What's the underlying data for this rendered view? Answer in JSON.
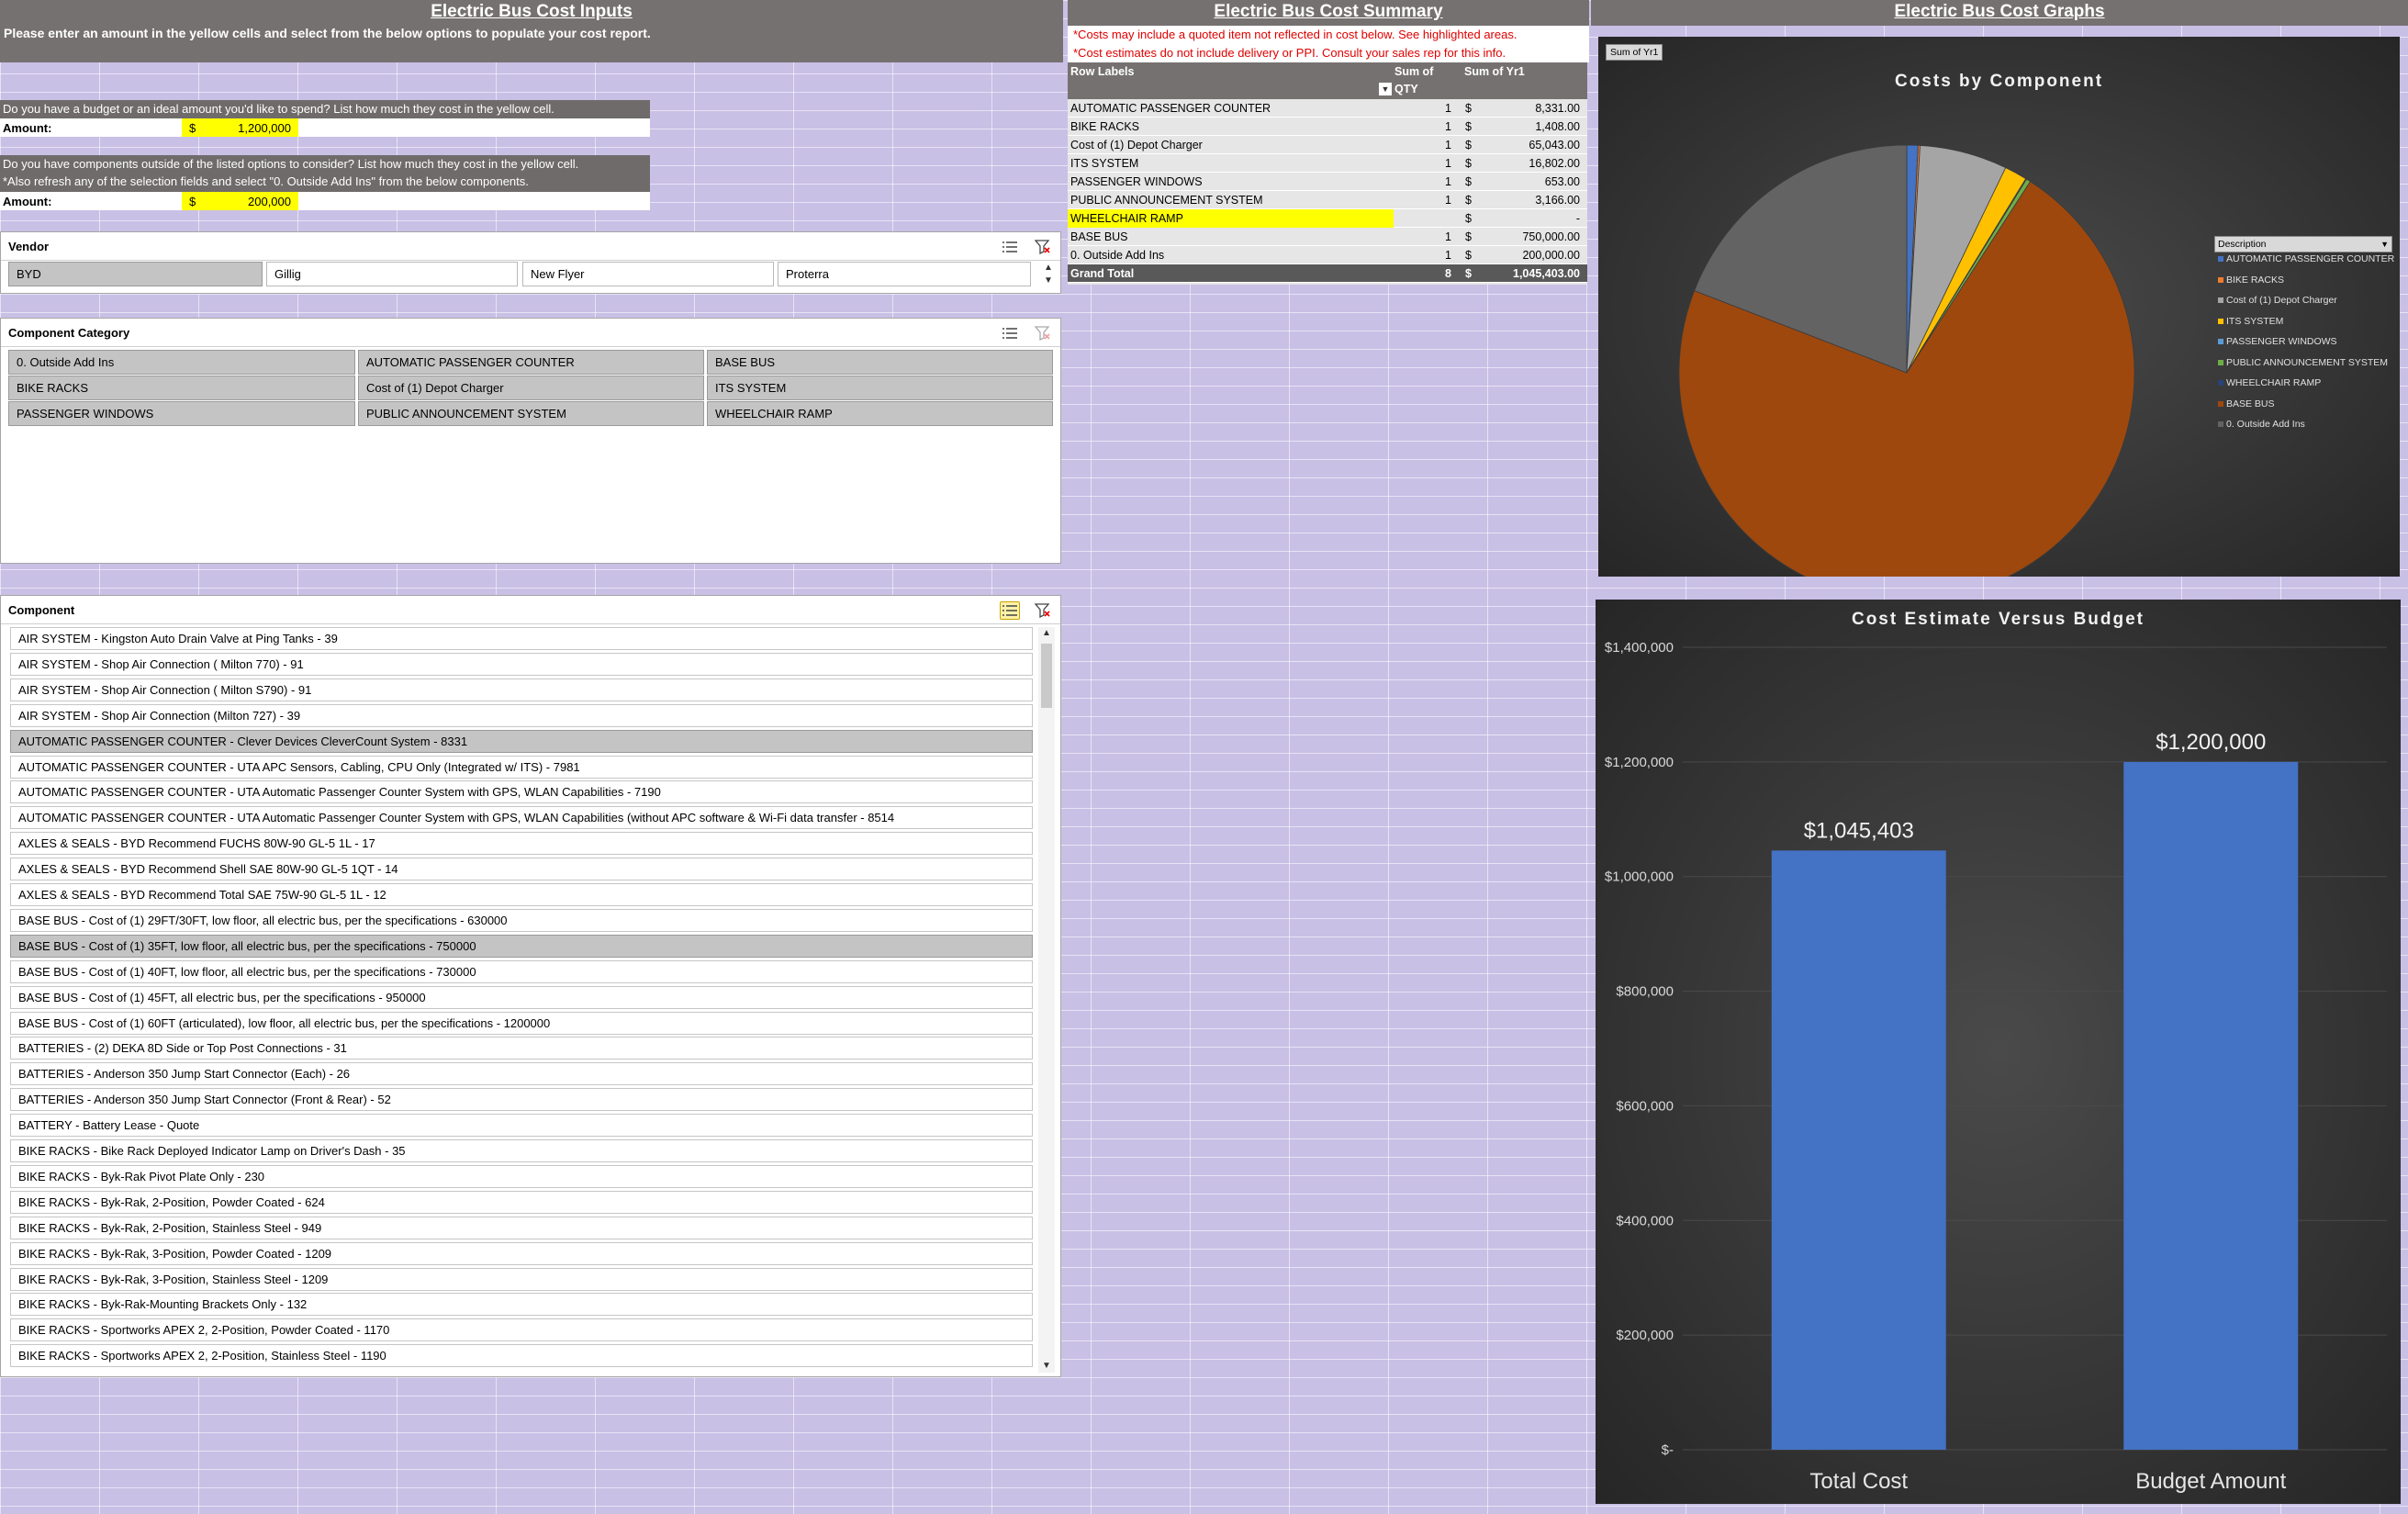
{
  "inputs": {
    "title": "Electric Bus Cost Inputs",
    "subtitle": "Please enter an amount in the yellow cells and select from the below options to populate your cost report.",
    "budget_question": "Do you have a budget or an ideal amount you'd like to spend? List how much they cost in the yellow cell.",
    "amount_label": "Amount:",
    "budget_currency": "$",
    "budget_amount": "1,200,000",
    "outside_question": "Do you have components outside of the listed options to consider? List how much they cost in the yellow cell.",
    "outside_note": "*Also refresh any of the selection fields and select \"0. Outside Add Ins\" from the below components.",
    "outside_currency": "$",
    "outside_amount": "200,000"
  },
  "vendor_slicer": {
    "title": "Vendor",
    "items": [
      "BYD",
      "Gillig",
      "New Flyer",
      "Proterra"
    ],
    "selected": "BYD"
  },
  "category_slicer": {
    "title": "Component Category",
    "items": [
      "0. Outside Add Ins",
      "AUTOMATIC PASSENGER COUNTER",
      "BASE BUS",
      "BIKE RACKS",
      "Cost of (1) Depot Charger",
      "ITS SYSTEM",
      "PASSENGER WINDOWS",
      "PUBLIC ANNOUNCEMENT SYSTEM",
      "WHEELCHAIR RAMP"
    ]
  },
  "component_slicer": {
    "title": "Component",
    "items": [
      "AIR SYSTEM - Kingston Auto Drain Valve at Ping Tanks - 39",
      "AIR SYSTEM - Shop Air Connection ( Milton 770) - 91",
      "AIR SYSTEM - Shop Air Connection ( Milton S790) - 91",
      "AIR SYSTEM - Shop Air Connection (Milton 727) - 39",
      "AUTOMATIC PASSENGER COUNTER - Clever Devices CleverCount System - 8331",
      "AUTOMATIC PASSENGER COUNTER - UTA APC Sensors, Cabling, CPU Only (Integrated w/ ITS) - 7981",
      "AUTOMATIC PASSENGER COUNTER - UTA Automatic Passenger Counter System with GPS, WLAN Capabilities - 7190",
      "AUTOMATIC PASSENGER COUNTER - UTA Automatic Passenger Counter System with GPS, WLAN Capabilities (without APC software & Wi-Fi data transfer - 8514",
      "AXLES & SEALS - BYD Recommend FUCHS 80W-90 GL-5 1L - 17",
      "AXLES & SEALS - BYD Recommend Shell SAE 80W-90 GL-5 1QT - 14",
      "AXLES & SEALS - BYD Recommend Total SAE 75W-90 GL-5 1L - 12",
      "BASE BUS - Cost of (1) 29FT/30FT, low floor, all electric bus, per the specifications - 630000",
      "BASE BUS - Cost of (1) 35FT, low floor, all electric bus, per the specifications - 750000",
      "BASE BUS - Cost of (1) 40FT, low floor, all electric bus, per the specifications - 730000",
      "BASE BUS - Cost of (1) 45FT, all electric bus, per the specifications - 950000",
      "BASE BUS - Cost of (1) 60FT (articulated), low floor, all electric bus, per the specifications - 1200000",
      "BATTERIES - (2) DEKA 8D Side or Top Post Connections - 31",
      "BATTERIES - Anderson 350 Jump Start Connector (Each) - 26",
      "BATTERIES - Anderson 350 Jump Start Connector (Front & Rear) - 52",
      "BATTERY - Battery Lease - Quote",
      "BIKE RACKS - Bike Rack Deployed Indicator Lamp on Driver's Dash - 35",
      "BIKE RACKS - Byk-Rak Pivot Plate Only - 230",
      "BIKE RACKS - Byk-Rak, 2-Position, Powder Coated - 624",
      "BIKE RACKS - Byk-Rak, 2-Position, Stainless Steel - 949",
      "BIKE RACKS - Byk-Rak, 3-Position, Powder Coated - 1209",
      "BIKE RACKS - Byk-Rak, 3-Position, Stainless Steel - 1209",
      "BIKE RACKS - Byk-Rak-Mounting Brackets Only - 132",
      "BIKE RACKS - Sportworks APEX 2, 2-Position, Powder Coated - 1170",
      "BIKE RACKS - Sportworks APEX 2, 2-Position, Stainless Steel - 1190"
    ],
    "selected": [
      4,
      12
    ]
  },
  "summary": {
    "title": "Electric Bus Cost Summary",
    "note1": "*Costs may include a quoted item not reflected in cost below. See highlighted areas.",
    "note2": "*Cost estimates do not include delivery or PPI. Consult your sales rep for this info.",
    "col_row_labels": "Row Labels",
    "col_qty_1": "Sum of",
    "col_qty_2": "QTY",
    "col_yr1": "Sum of Yr1",
    "rows": [
      {
        "label": "AUTOMATIC PASSENGER COUNTER",
        "qty": "1",
        "cur": "$",
        "value": "8,331.00"
      },
      {
        "label": "BIKE RACKS",
        "qty": "1",
        "cur": "$",
        "value": "1,408.00"
      },
      {
        "label": "Cost of (1) Depot Charger",
        "qty": "1",
        "cur": "$",
        "value": "65,043.00"
      },
      {
        "label": "ITS SYSTEM",
        "qty": "1",
        "cur": "$",
        "value": "16,802.00"
      },
      {
        "label": "PASSENGER WINDOWS",
        "qty": "1",
        "cur": "$",
        "value": "653.00"
      },
      {
        "label": "PUBLIC ANNOUNCEMENT SYSTEM",
        "qty": "1",
        "cur": "$",
        "value": "3,166.00"
      },
      {
        "label": "WHEELCHAIR RAMP",
        "qty": "",
        "cur": "$",
        "value": "-"
      },
      {
        "label": "BASE BUS",
        "qty": "1",
        "cur": "$",
        "value": "750,000.00"
      },
      {
        "label": "0. Outside Add Ins",
        "qty": "1",
        "cur": "$",
        "value": "200,000.00"
      }
    ],
    "highlighted_row": 6,
    "grand_total": {
      "label": "Grand Total",
      "qty": "8",
      "cur": "$",
      "value": "1,045,403.00"
    }
  },
  "graphs": {
    "title": "Electric Bus Cost Graphs",
    "field_button": "Sum of Yr1",
    "legend_button": "Description"
  },
  "chart_data": [
    {
      "type": "pie",
      "title": "Costs by Component",
      "labels": [
        "AUTOMATIC PASSENGER COUNTER",
        "BIKE RACKS",
        "Cost of (1) Depot Charger",
        "ITS SYSTEM",
        "PASSENGER WINDOWS",
        "PUBLIC ANNOUNCEMENT SYSTEM",
        "WHEELCHAIR RAMP",
        "BASE BUS",
        "0. Outside Add Ins"
      ],
      "values": [
        8331,
        1408,
        65043,
        16802,
        653,
        3166,
        0,
        750000,
        200000
      ],
      "colors": [
        "#4472c4",
        "#ed7d31",
        "#a5a5a5",
        "#ffc000",
        "#5b9bd5",
        "#70ad47",
        "#264478",
        "#9e480e",
        "#636363"
      ],
      "legend_position": "right"
    },
    {
      "type": "bar",
      "title": "Cost Estimate Versus Budget",
      "categories": [
        "Total Cost",
        "Budget Amount"
      ],
      "values": [
        1045403,
        1200000
      ],
      "data_labels": [
        "$1,045,403",
        "$1,200,000"
      ],
      "ylim": [
        0,
        1400000
      ],
      "yticks": [
        0,
        200000,
        400000,
        600000,
        800000,
        1000000,
        1200000,
        1400000
      ],
      "ytick_labels": [
        "$-",
        "$200,000",
        "$400,000",
        "$600,000",
        "$800,000",
        "$1,000,000",
        "$1,200,000",
        "$1,400,000"
      ],
      "bar_color": "#4472c4"
    }
  ]
}
